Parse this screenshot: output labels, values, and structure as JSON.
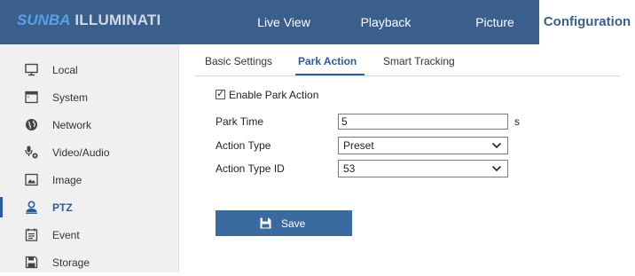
{
  "brand": {
    "part1": "SUNBA",
    "part2": " ILLUMINATI"
  },
  "nav": [
    {
      "label": "Live View"
    },
    {
      "label": "Playback"
    },
    {
      "label": "Picture"
    },
    {
      "label": "Configuration"
    }
  ],
  "sidebar": {
    "items": [
      {
        "label": "Local",
        "icon": "monitor-icon"
      },
      {
        "label": "System",
        "icon": "window-icon"
      },
      {
        "label": "Network",
        "icon": "globe-icon"
      },
      {
        "label": "Video/Audio",
        "icon": "microphone-camera-icon"
      },
      {
        "label": "Image",
        "icon": "image-icon"
      },
      {
        "label": "PTZ",
        "icon": "user-ptz-icon"
      },
      {
        "label": "Event",
        "icon": "calendar-icon"
      },
      {
        "label": "Storage",
        "icon": "save-disk-icon"
      }
    ],
    "active": "PTZ"
  },
  "tabs": [
    {
      "label": "Basic Settings"
    },
    {
      "label": "Park Action"
    },
    {
      "label": "Smart Tracking"
    }
  ],
  "form": {
    "enable_label": "Enable Park Action",
    "enable_checked": true,
    "park_time_label": "Park Time",
    "park_time_value": "5",
    "park_time_unit": "s",
    "action_type_label": "Action Type",
    "action_type_value": "Preset",
    "action_type_id_label": "Action Type ID",
    "action_type_id_value": "53"
  },
  "save_label": "Save",
  "colors": {
    "header": "#3a5f8c",
    "accent": "#2e5b9a",
    "button": "#3a6aa0"
  }
}
